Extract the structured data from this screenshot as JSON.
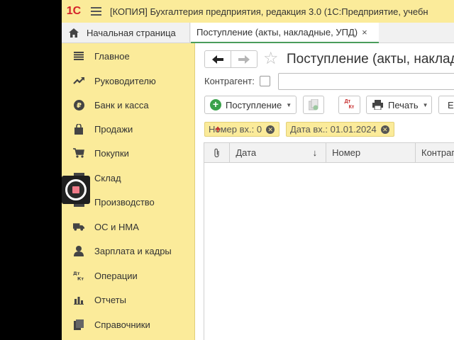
{
  "titlebar": {
    "logo": "1С",
    "title": "[КОПИЯ] Бухгалтерия предприятия, редакция 3.0  (1С:Предприятие, учебн"
  },
  "tabs": {
    "home": "Начальная страница",
    "document": "Поступление (акты, накладные, УПД)",
    "close_symbol": "×"
  },
  "sidebar": {
    "items": [
      {
        "label": "Главное",
        "icon": "list-icon"
      },
      {
        "label": "Руководителю",
        "icon": "trend-icon"
      },
      {
        "label": "Банк и касса",
        "icon": "ruble-coin-icon"
      },
      {
        "label": "Продажи",
        "icon": "shopping-bag-icon"
      },
      {
        "label": "Покупки",
        "icon": "cart-icon"
      },
      {
        "label": "Склад",
        "icon": "warehouse-icon"
      },
      {
        "label": "Производство",
        "icon": "factory-icon"
      },
      {
        "label": "ОС и НМА",
        "icon": "truck-icon"
      },
      {
        "label": "Зарплата и кадры",
        "icon": "person-icon"
      },
      {
        "label": "Операции",
        "icon": "dt-kt-icon"
      },
      {
        "label": "Отчеты",
        "icon": "bar-chart-icon"
      },
      {
        "label": "Справочники",
        "icon": "books-icon"
      }
    ]
  },
  "content": {
    "back_symbol": "🡐",
    "forward_symbol": "🡒",
    "star_symbol": "☆",
    "title": "Поступление (акты, накладные, УПД)",
    "kontragent_label": "Контрагент:",
    "kontragent_value": ""
  },
  "toolbar": {
    "post_label": "Поступление",
    "print_label": "Печать",
    "more_label": "Е",
    "dt": "Дт",
    "kt": "Кт"
  },
  "filters": [
    {
      "label": "Номер вх.: 0"
    },
    {
      "label": "Дата вх.: 01.01.2024"
    }
  ],
  "table": {
    "columns": [
      "Дата",
      "Номер",
      "Контрагент"
    ],
    "sort_symbol": "↓",
    "rows": []
  },
  "colors": {
    "sidebar_bg": "#fbeb9a",
    "accent_green": "#3aa14a",
    "logo_red": "#d4232a"
  }
}
